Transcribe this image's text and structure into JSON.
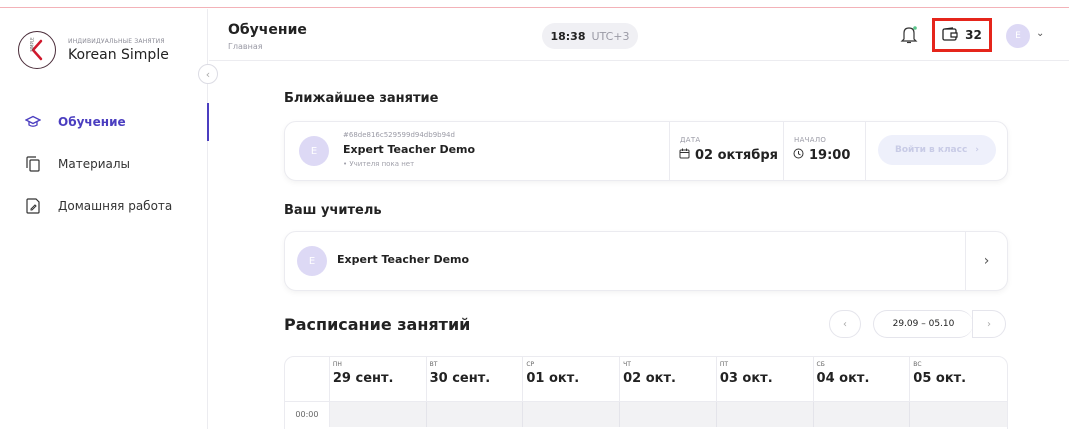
{
  "brand": {
    "subtitle": "ИНДИВИДУАЛЬНЫЕ ЗАНЯТИЯ",
    "name": "Korean Simple",
    "logo_small_text": "SIMPLE"
  },
  "sidebar": {
    "items": [
      {
        "label": "Обучение",
        "icon": "graduation-cap-icon",
        "active": true
      },
      {
        "label": "Материалы",
        "icon": "copy-icon",
        "active": false
      },
      {
        "label": "Домашняя работа",
        "icon": "edit-document-icon",
        "active": false
      }
    ]
  },
  "header": {
    "title": "Обучение",
    "breadcrumb": "Главная",
    "time": "18:38",
    "timezone": "UTC+3",
    "balance": "32"
  },
  "next_lesson": {
    "section_title": "Ближайшее занятие",
    "avatar_letter": "E",
    "id": "#68de816c529599d94db9b94d",
    "teacher": "Expert Teacher Demo",
    "note": "Учителя пока нет",
    "date_label": "ДАТА",
    "date_value": "02 октября",
    "start_label": "НАЧАЛО",
    "start_value": "19:00",
    "join_button": "Войти в класс"
  },
  "your_teacher": {
    "section_title": "Ваш учитель",
    "avatar_letter": "E",
    "name": "Expert Teacher Demo"
  },
  "schedule": {
    "title": "Расписание занятий",
    "range": "29.09 – 05.10",
    "days": [
      {
        "weekday": "ПН",
        "date": "29 сент."
      },
      {
        "weekday": "ВТ",
        "date": "30 сент."
      },
      {
        "weekday": "СР",
        "date": "01 окт."
      },
      {
        "weekday": "ЧТ",
        "date": "02 окт."
      },
      {
        "weekday": "ПТ",
        "date": "03 окт."
      },
      {
        "weekday": "СБ",
        "date": "04 окт."
      },
      {
        "weekday": "ВС",
        "date": "05 окт."
      }
    ],
    "first_time": "00:00"
  },
  "colors": {
    "accent": "#4b3ec0",
    "highlight": "#e5251b",
    "avatar": "#ddd9f5"
  }
}
